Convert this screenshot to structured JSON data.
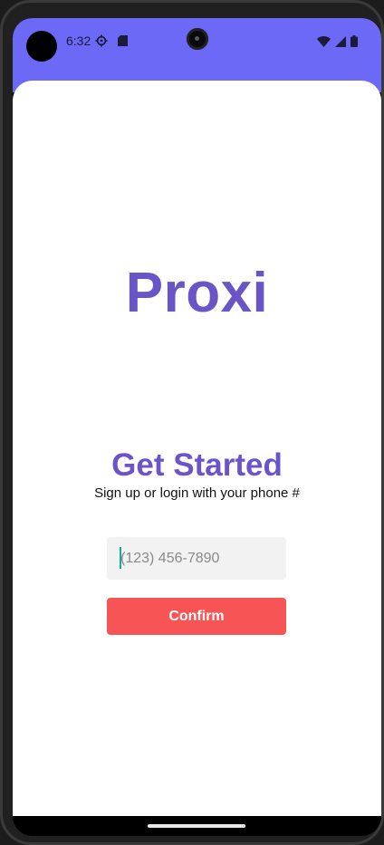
{
  "status_bar": {
    "time": "6:32",
    "background_color": "#6c69f7",
    "icons": [
      "settings-gear-icon",
      "sd-card-icon",
      "wifi-icon",
      "cell-signal-icon",
      "battery-icon"
    ]
  },
  "app": {
    "logo": "Proxi",
    "headline": "Get Started",
    "subtitle": "Sign up or login with your phone #",
    "phone_input": {
      "placeholder": "(123) 456-7890",
      "value": ""
    },
    "confirm_label": "Confirm",
    "colors": {
      "brand": "#6a55c8",
      "confirm": "#f75555",
      "input_bg": "#f2f2f2"
    }
  }
}
